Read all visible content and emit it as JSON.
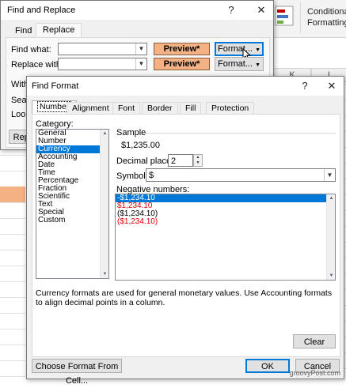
{
  "excel": {
    "ribbon": {
      "conditional_formatting": "Conditional Formatting"
    },
    "columns": [
      "K",
      "L"
    ]
  },
  "find_replace": {
    "title": "Find and Replace",
    "help_glyph": "?",
    "close_glyph": "✕",
    "tabs": [
      "Find",
      "Replace"
    ],
    "find_what_label": "Find what:",
    "replace_with_label": "Replace with:",
    "find_what_value": "",
    "replace_with_value": "",
    "preview_label": "Preview*",
    "format_button": "Format...",
    "within_label": "Withi",
    "search_label": "Searc",
    "look_label": "Look",
    "replace_all_partial": "Repla"
  },
  "find_format": {
    "title": "Find Format",
    "help_glyph": "?",
    "close_glyph": "✕",
    "tabs": [
      "Number",
      "Alignment",
      "Font",
      "Border",
      "Fill",
      "Protection"
    ],
    "category_label": "Category:",
    "categories": [
      "General",
      "Number",
      "Currency",
      "Accounting",
      "Date",
      "Time",
      "Percentage",
      "Fraction",
      "Scientific",
      "Text",
      "Special",
      "Custom"
    ],
    "selected_category": "Currency",
    "sample_label": "Sample",
    "sample_value": "$1,235.00",
    "decimal_places_label": "Decimal places:",
    "decimal_places_value": "2",
    "symbol_label": "Symbol:",
    "symbol_value": "$",
    "negative_numbers_label": "Negative numbers:",
    "negative_numbers": [
      {
        "text": "-$1,234.10",
        "red": false,
        "selected": true
      },
      {
        "text": "$1,234.10",
        "red": true,
        "selected": false
      },
      {
        "text": "($1,234.10)",
        "red": false,
        "selected": false
      },
      {
        "text": "($1,234.10)",
        "red": true,
        "selected": false
      }
    ],
    "description": "Currency formats are used for general monetary values.  Use Accounting formats to align decimal points in a column.",
    "clear_button": "Clear",
    "choose_format_button": "Choose Format From Cell...",
    "ok_button": "OK",
    "cancel_button": "Cancel"
  },
  "watermark": "groovyPost.com",
  "colors": {
    "accent": "#0078d7",
    "preview_fill": "#f4b183",
    "negative_red": "#e00000"
  }
}
